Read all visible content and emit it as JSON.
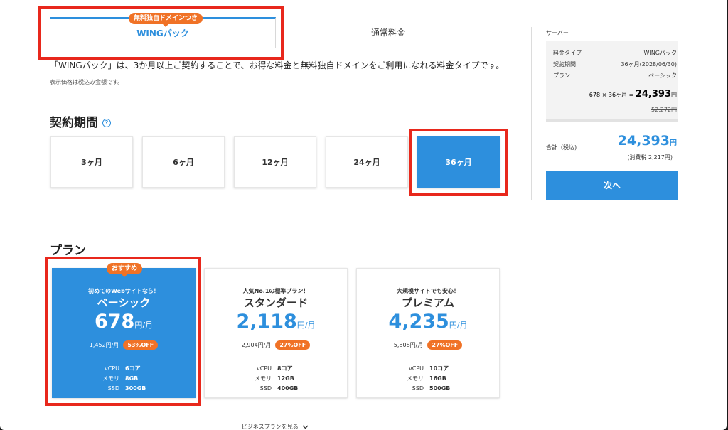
{
  "tabs": {
    "wing_label": "WINGパック",
    "wing_badge": "無料独自ドメインつき",
    "normal_label": "通常料金"
  },
  "description": "「WINGパック」は、3か月以上ご契約することで、お得な料金と無料独自ドメインをご利用になれる料金タイプです。",
  "tax_note": "表示価格は税込み金額です。",
  "period": {
    "title": "契約期間",
    "help_icon": "?",
    "options": [
      "3ヶ月",
      "6ヶ月",
      "12ヶ月",
      "24ヶ月",
      "36ヶ月"
    ],
    "selected": "36ヶ月"
  },
  "plans": {
    "title": "プラン",
    "recommend_badge": "おすすめ",
    "items": [
      {
        "tagline": "初めてのWebサイトなら！",
        "name": "ベーシック",
        "price": "678",
        "unit": "円/月",
        "old": "1,452円/月",
        "off": "53%OFF",
        "cpu_k": "vCPU",
        "cpu_v": "6コア",
        "mem_k": "メモリ",
        "mem_v": "8GB",
        "ssd_k": "SSD",
        "ssd_v": "300GB"
      },
      {
        "tagline": "人気No.1の標準プラン！",
        "name": "スタンダード",
        "price": "2,118",
        "unit": "円/月",
        "old": "2,904円/月",
        "off": "27%OFF",
        "cpu_k": "vCPU",
        "cpu_v": "8コア",
        "mem_k": "メモリ",
        "mem_v": "12GB",
        "ssd_k": "SSD",
        "ssd_v": "400GB"
      },
      {
        "tagline": "大規模サイトでも安心！",
        "name": "プレミアム",
        "price": "4,235",
        "unit": "円/月",
        "old": "5,808円/月",
        "off": "27%OFF",
        "cpu_k": "vCPU",
        "cpu_v": "10コア",
        "mem_k": "メモリ",
        "mem_v": "16GB",
        "ssd_k": "SSD",
        "ssd_v": "500GB"
      }
    ],
    "business_link": "ビジネスプランを見る"
  },
  "summary": {
    "title": "サーバー",
    "fee_type_k": "料金タイプ",
    "fee_type_v": "WINGパック",
    "period_k": "契約期間",
    "period_v": "36ヶ月(2028/06/30)",
    "plan_k": "プラン",
    "plan_v": "ベーシック",
    "calc_prefix": "678 × 36ヶ月 =",
    "calc_value": "24,393",
    "calc_unit": "円",
    "old_total": "52,272円",
    "total_k": "合計（税込)",
    "total_v": "24,393",
    "total_unit": "円",
    "tax": "(消費税 2,217円)",
    "next_button": "次へ"
  },
  "colors": {
    "accent": "#2d8fdd",
    "badge": "#f07226",
    "highlight": "#e8281c"
  }
}
